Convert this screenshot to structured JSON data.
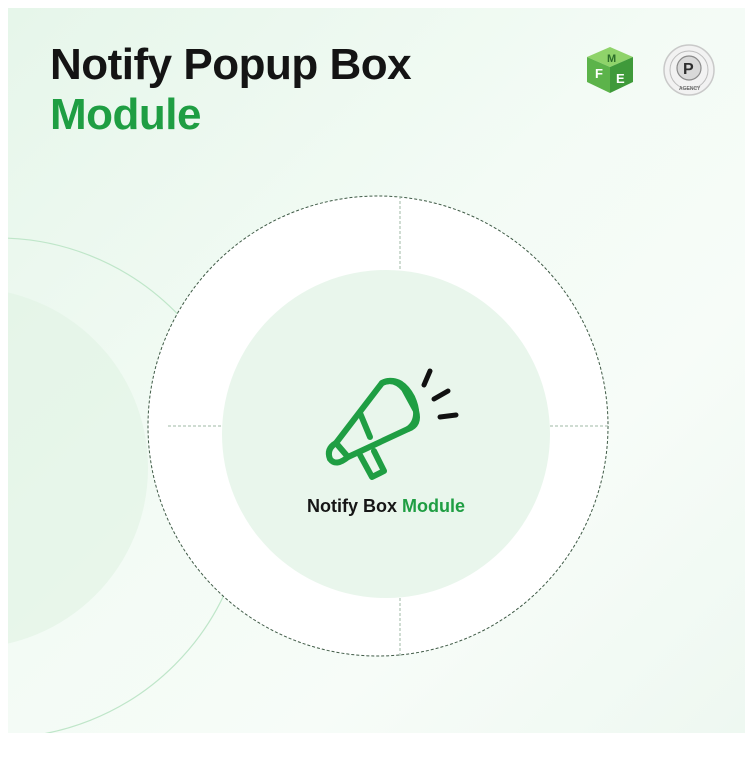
{
  "header": {
    "title_line1": "Notify Popup Box",
    "title_line2": "Module"
  },
  "badge": {
    "label_first": "Notify Box",
    "label_second": "Module"
  },
  "logos": {
    "fme": {
      "icon": "fme-cube-logo",
      "letters": "FME"
    },
    "prestashop": {
      "icon": "prestashop-partner-seal",
      "letter": "P",
      "ring_text": "PRESTASHOP PARTNER · AGENCY"
    }
  },
  "icons": {
    "center": "megaphone-icon"
  },
  "colors": {
    "brand_green": "#1f9e43",
    "title_dark": "#141414",
    "bg_tint": "#e6f6ea"
  }
}
